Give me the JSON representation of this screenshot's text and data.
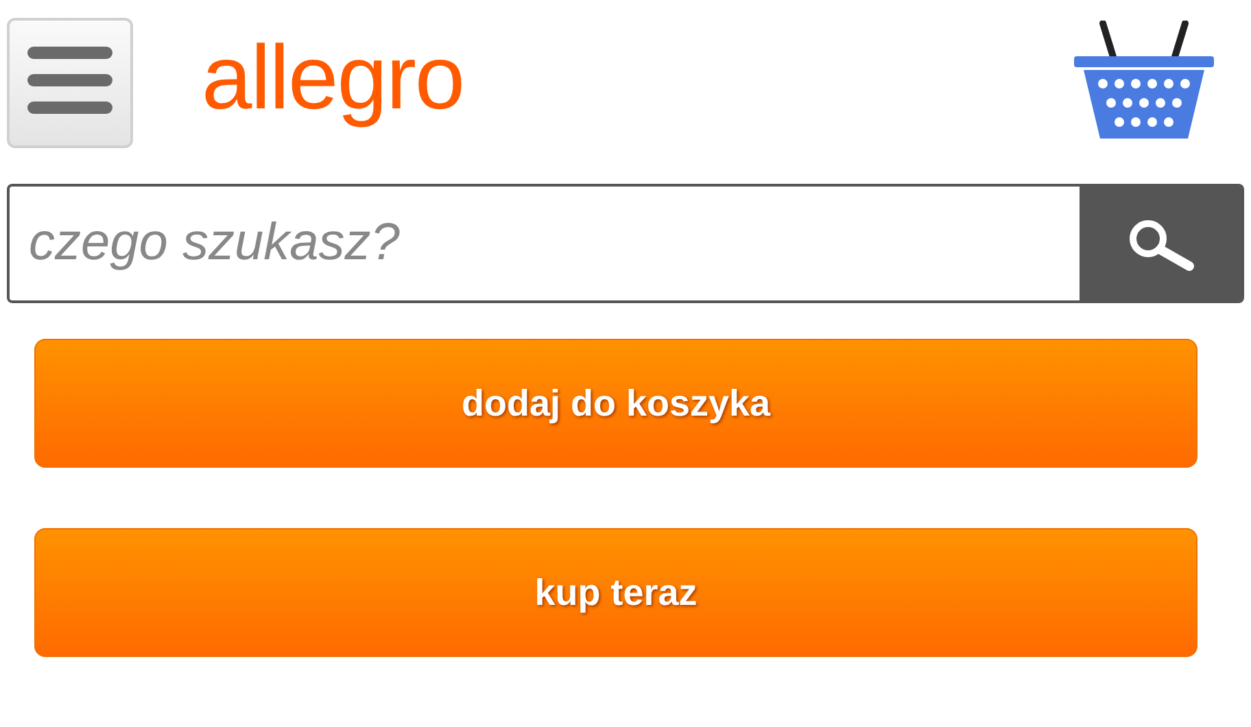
{
  "header": {
    "logo": "allegro"
  },
  "search": {
    "placeholder": "czego szukasz?"
  },
  "buttons": [
    {
      "label": "dodaj do koszyka"
    },
    {
      "label": "kup teraz"
    }
  ]
}
